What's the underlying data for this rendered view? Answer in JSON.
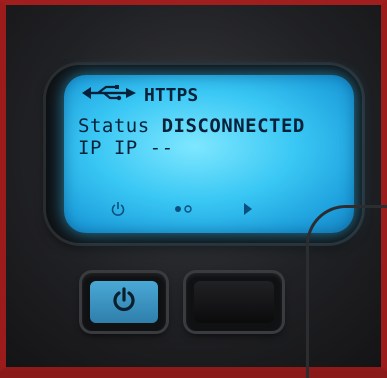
{
  "display": {
    "title": "HTTPS",
    "status_label": "Status",
    "status_value": "DISCONNECTED",
    "ip_label": "IP IP",
    "ip_value": "--"
  },
  "icons": {
    "usb": "usb-icon",
    "softkey_power": "power-icon",
    "softkey_dots": "dots-icon",
    "softkey_next": "arrow-right-icon",
    "power_button": "power-icon"
  },
  "colors": {
    "lcd_backlight": "#39c7f4",
    "lcd_text": "#06213a",
    "power_button": "#3a93c2"
  }
}
